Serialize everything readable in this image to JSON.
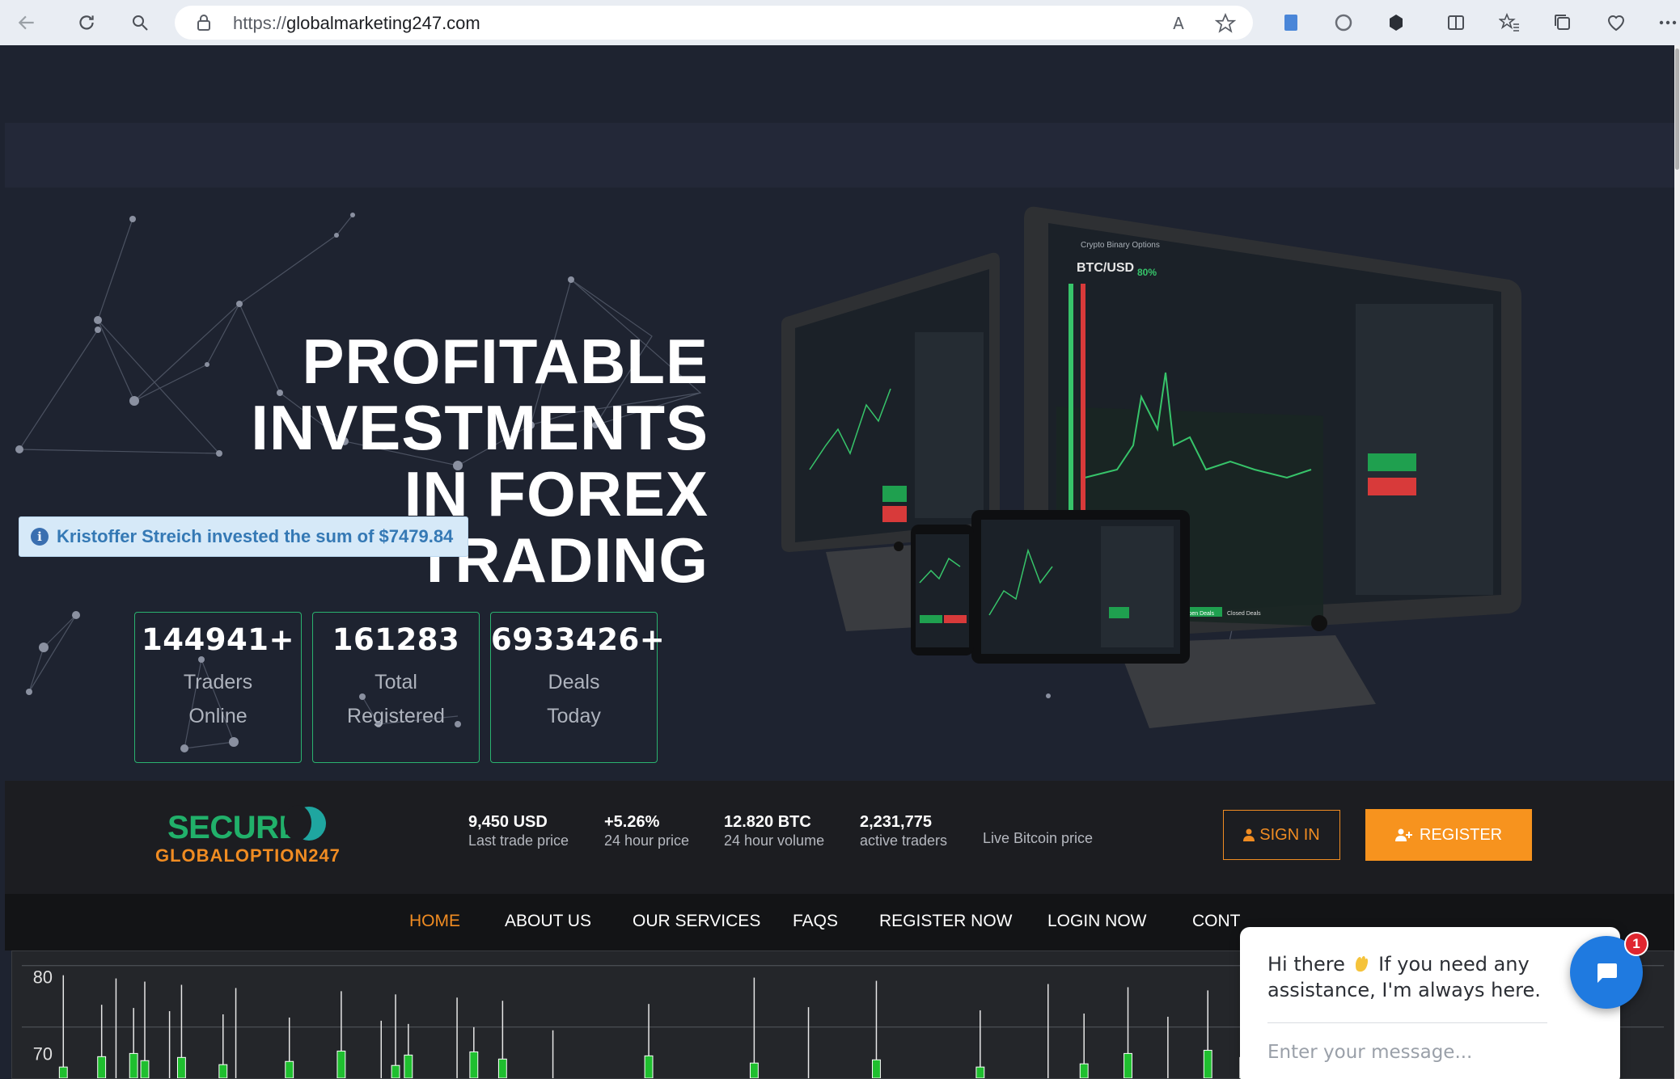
{
  "browser": {
    "url_prefix": "https://",
    "url_host": "globalmarketing247.com",
    "read_aloud_label": "A"
  },
  "hero": {
    "title_lines": [
      "PROFITABLE",
      "INVESTMENTS",
      "IN FOREX",
      "TRADING"
    ],
    "notification": "Kristoffer Streich invested the sum of $7479.84",
    "stats": [
      {
        "value": "144941+",
        "label_line1": "Traders",
        "label_line2": "Online"
      },
      {
        "value": "161283",
        "label_line1": "Total",
        "label_line2": "Registered"
      },
      {
        "value": "6933426+",
        "label_line1": "Deals",
        "label_line2": "Today"
      }
    ]
  },
  "devices": {
    "monitor_pair": "BTC/USD",
    "monitor_pct": "80%",
    "monitor_title": "Crypto Binary Options",
    "open_deals": "Open Deals",
    "closed_deals": "Closed Deals"
  },
  "ticker": {
    "logo_main": "SECURE",
    "logo_sub": "GLOBALOPTION247",
    "items": [
      {
        "value": "9,450 USD",
        "label": "Last trade price"
      },
      {
        "value": "+5.26%",
        "label": "24 hour price"
      },
      {
        "value": "12.820 BTC",
        "label": "24 hour volume"
      },
      {
        "value": "2,231,775",
        "label": "active traders"
      }
    ],
    "live_label": "Live Bitcoin price",
    "signin_label": "SIGN IN",
    "register_label": "REGISTER"
  },
  "nav": {
    "items": [
      "HOME",
      "ABOUT US",
      "OUR SERVICES",
      "FAQS",
      "REGISTER NOW",
      "LOGIN NOW",
      "CONT"
    ],
    "active": "HOME"
  },
  "chart": {
    "y_labels": [
      "80",
      "70"
    ]
  },
  "chat": {
    "greeting_pre": "Hi there ",
    "greeting_post": " If you need any assistance, I'm always here.",
    "input_placeholder": "Enter your message...",
    "unread": "1"
  },
  "colors": {
    "accent_orange": "#f7931e",
    "accent_green": "#21b06a",
    "chat_blue": "#1f7ae0",
    "page_bg": "#1e2330"
  },
  "icons": [
    "back-icon",
    "refresh-icon",
    "search-icon",
    "lock-icon",
    "read-aloud-icon",
    "favorite-star-icon",
    "extension-icon",
    "split-screen-icon",
    "favorites-icon",
    "collections-icon",
    "health-icon",
    "more-icon",
    "info-icon",
    "user-icon",
    "user-plus-icon",
    "chat-icon",
    "wave-emoji-icon"
  ]
}
